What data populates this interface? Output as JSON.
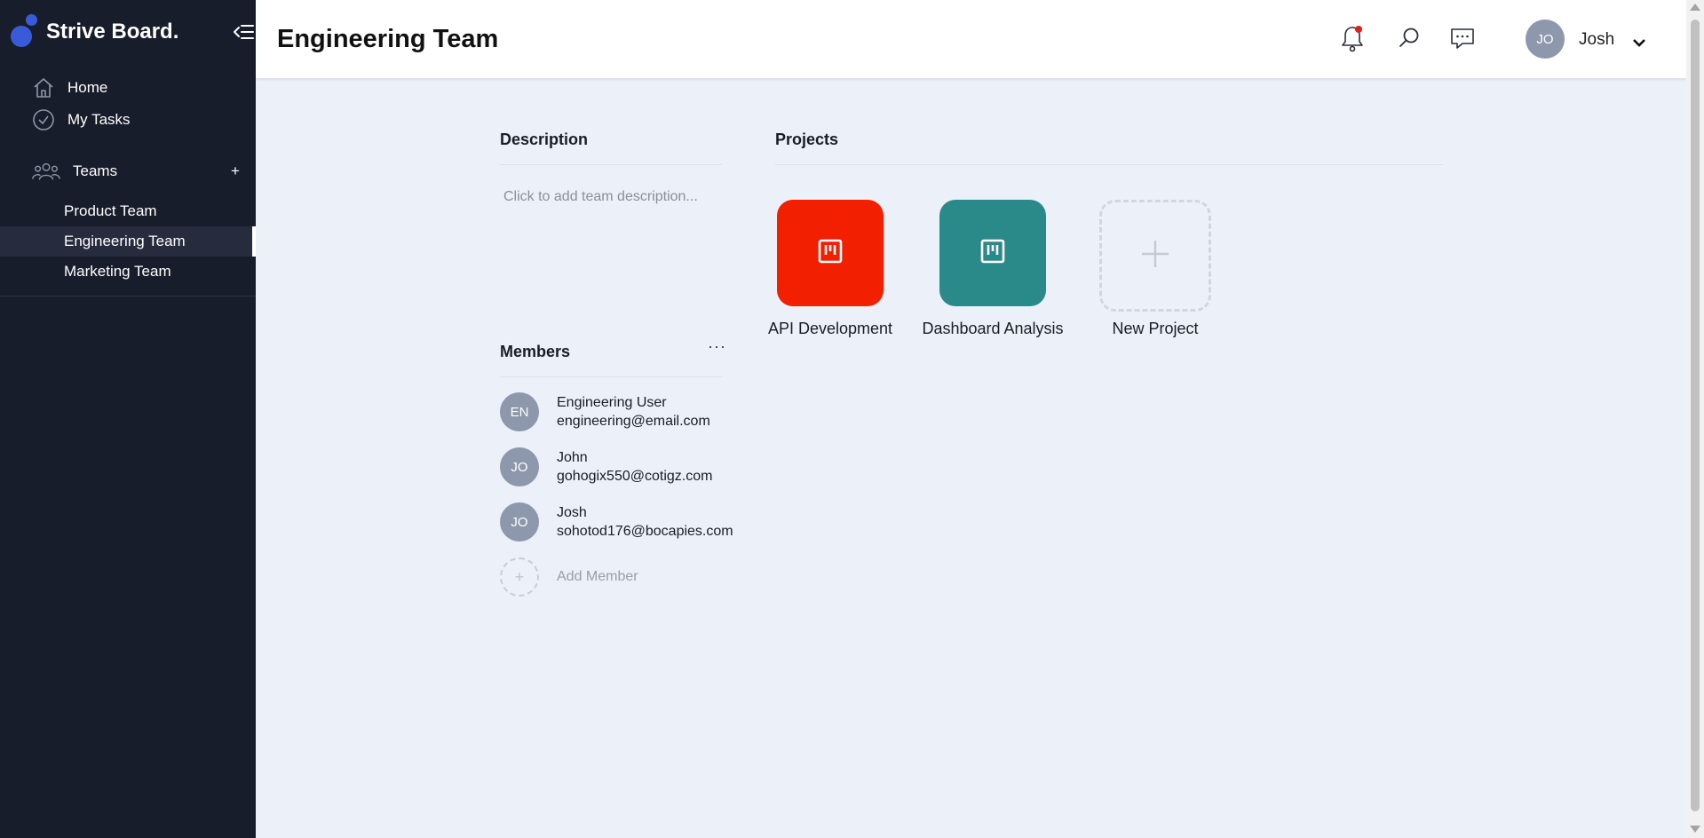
{
  "brand": {
    "name": "Strive Board.",
    "accent": "#3a5bd9"
  },
  "sidebar": {
    "nav": [
      {
        "label": "Home",
        "icon": "home-icon"
      },
      {
        "label": "My Tasks",
        "icon": "check-circle-icon"
      }
    ],
    "teams_label": "Teams",
    "teams_add": "+",
    "teams": [
      {
        "label": "Product Team",
        "active": false
      },
      {
        "label": "Engineering Team",
        "active": true
      },
      {
        "label": "Marketing Team",
        "active": false
      }
    ]
  },
  "header": {
    "title": "Engineering Team",
    "user": {
      "initials": "JO",
      "name": "Josh"
    },
    "icons": [
      "bell-icon",
      "search-icon",
      "chat-icon",
      "chevron-down-icon"
    ]
  },
  "description": {
    "title": "Description",
    "placeholder": "Click to add team description..."
  },
  "members": {
    "title": "Members",
    "more": "···",
    "list": [
      {
        "initials": "EN",
        "name": "Engineering User",
        "email": "engineering@email.com"
      },
      {
        "initials": "JO",
        "name": "John",
        "email": "gohogix550@cotigz.com"
      },
      {
        "initials": "JO",
        "name": "Josh",
        "email": "sohotod176@bocapies.com"
      }
    ],
    "add_label": "Add Member",
    "add_icon": "+"
  },
  "projects": {
    "title": "Projects",
    "list": [
      {
        "name": "API Development",
        "color": "#f21f00",
        "icon": "board-icon"
      },
      {
        "name": "Dashboard Analysis",
        "color": "#2a8a89",
        "icon": "board-icon"
      }
    ],
    "new_label": "New Project"
  }
}
